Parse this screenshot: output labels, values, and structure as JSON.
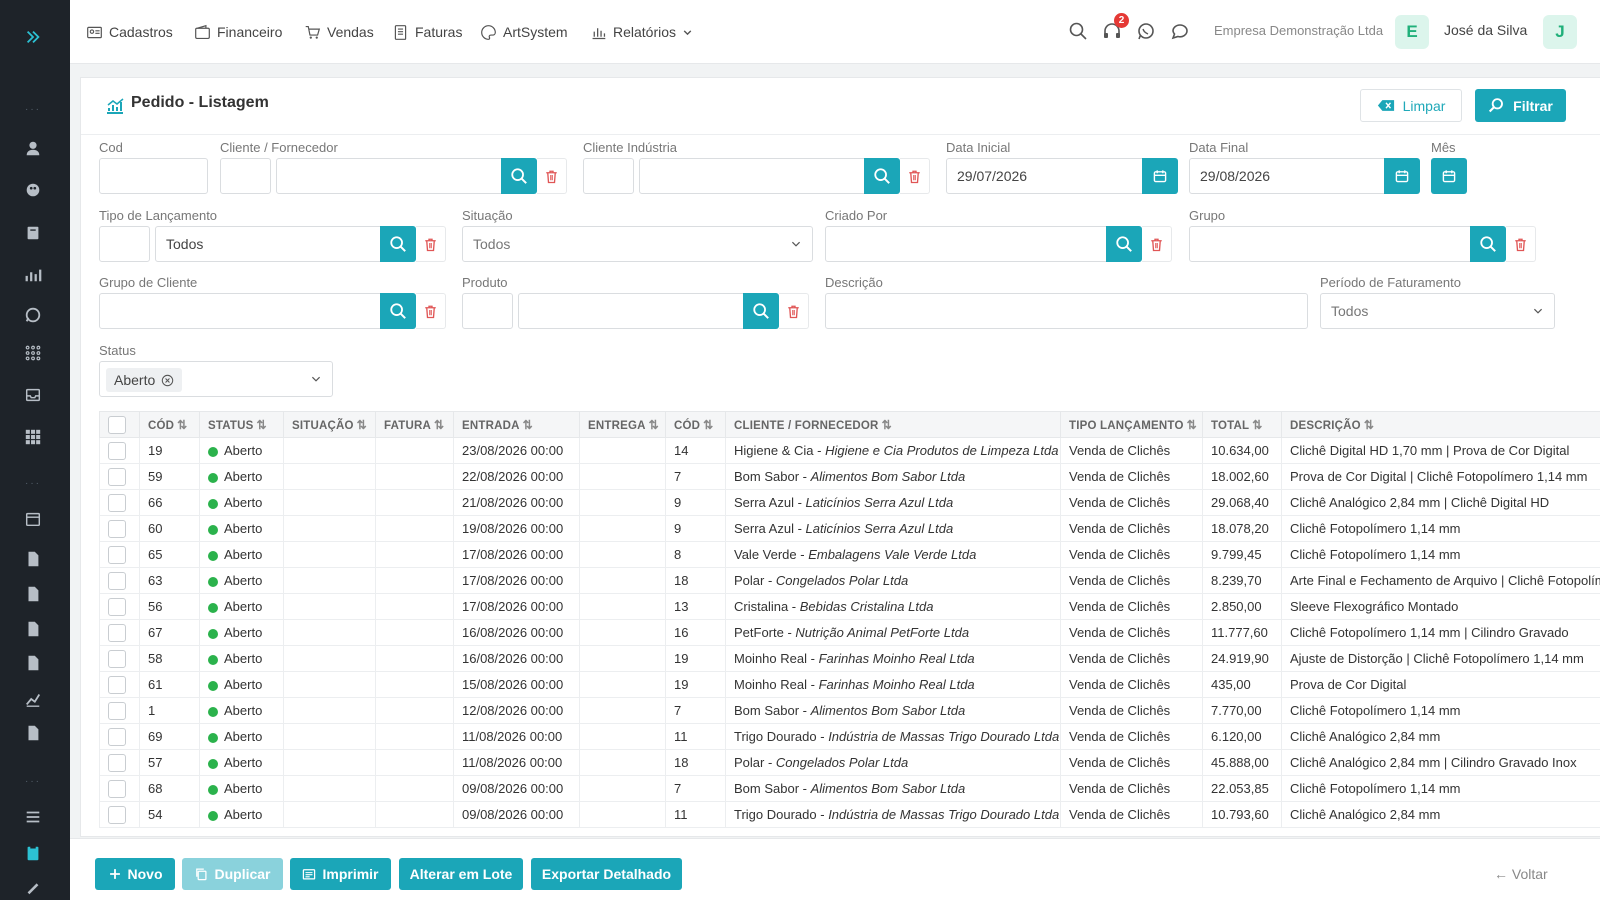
{
  "topnav": {
    "items": [
      "Cadastros",
      "Financeiro",
      "Vendas",
      "Faturas",
      "ArtSystem",
      "Relatórios"
    ],
    "notification_count": "2",
    "company": "Empresa Demonstração Ltda",
    "company_initial": "E",
    "user": "José da Silva",
    "user_initial": "J"
  },
  "page": {
    "title": "Pedido - Listagem",
    "clear_label": "Limpar",
    "filter_label": "Filtrar"
  },
  "filters": {
    "cod_label": "Cod",
    "cliente_label": "Cliente / Fornecedor",
    "industria_label": "Cliente Indústria",
    "data_inicial_label": "Data Inicial",
    "data_inicial": "29/07/2026",
    "data_final_label": "Data Final",
    "data_final": "29/08/2026",
    "mes_label": "Mês",
    "tipo_label": "Tipo de Lançamento",
    "tipo_value": "Todos",
    "situacao_label": "Situação",
    "situacao_value": "Todos",
    "criado_label": "Criado Por",
    "grupo_label": "Grupo",
    "grupo_cliente_label": "Grupo de Cliente",
    "produto_label": "Produto",
    "descricao_label": "Descrição",
    "periodo_label": "Período de Faturamento",
    "periodo_value": "Todos",
    "status_label": "Status",
    "status_tag": "Aberto"
  },
  "table": {
    "columns": [
      "CÓD",
      "STATUS",
      "SITUAÇÃO",
      "FATURA",
      "ENTRADA",
      "ENTREGA",
      "CÓD",
      "CLIENTE / FORNECEDOR",
      "TIPO LANÇAMENTO",
      "TOTAL",
      "DESCRIÇÃO"
    ],
    "rows": [
      {
        "cod": "19",
        "status": "Aberto",
        "entrada": "23/08/2026 00:00",
        "cli_cod": "14",
        "cliente": "Higiene & Cia",
        "razao": "Higiene e Cia Produtos de Limpeza Ltda",
        "tipo": "Venda de Clichês",
        "total": "10.634,00",
        "descricao": "Clichê Digital HD 1,70 mm | Prova de Cor Digital"
      },
      {
        "cod": "59",
        "status": "Aberto",
        "entrada": "22/08/2026 00:00",
        "cli_cod": "7",
        "cliente": "Bom Sabor",
        "razao": "Alimentos Bom Sabor Ltda",
        "tipo": "Venda de Clichês",
        "total": "18.002,60",
        "descricao": "Prova de Cor Digital | Clichê Fotopolímero 1,14 mm"
      },
      {
        "cod": "66",
        "status": "Aberto",
        "entrada": "21/08/2026 00:00",
        "cli_cod": "9",
        "cliente": "Serra Azul",
        "razao": "Laticínios Serra Azul Ltda",
        "tipo": "Venda de Clichês",
        "total": "29.068,40",
        "descricao": "Clichê Analógico 2,84 mm | Clichê Digital HD"
      },
      {
        "cod": "60",
        "status": "Aberto",
        "entrada": "19/08/2026 00:00",
        "cli_cod": "9",
        "cliente": "Serra Azul",
        "razao": "Laticínios Serra Azul Ltda",
        "tipo": "Venda de Clichês",
        "total": "18.078,20",
        "descricao": "Clichê Fotopolímero 1,14 mm"
      },
      {
        "cod": "65",
        "status": "Aberto",
        "entrada": "17/08/2026 00:00",
        "cli_cod": "8",
        "cliente": "Vale Verde",
        "razao": "Embalagens Vale Verde Ltda",
        "tipo": "Venda de Clichês",
        "total": "9.799,45",
        "descricao": "Clichê Fotopolímero 1,14 mm"
      },
      {
        "cod": "63",
        "status": "Aberto",
        "entrada": "17/08/2026 00:00",
        "cli_cod": "18",
        "cliente": "Polar",
        "razao": "Congelados Polar Ltda",
        "tipo": "Venda de Clichês",
        "total": "8.239,70",
        "descricao": "Arte Final e Fechamento de Arquivo | Clichê Fotopolímero"
      },
      {
        "cod": "56",
        "status": "Aberto",
        "entrada": "17/08/2026 00:00",
        "cli_cod": "13",
        "cliente": "Cristalina",
        "razao": "Bebidas Cristalina Ltda",
        "tipo": "Venda de Clichês",
        "total": "2.850,00",
        "descricao": "Sleeve Flexográfico Montado"
      },
      {
        "cod": "67",
        "status": "Aberto",
        "entrada": "16/08/2026 00:00",
        "cli_cod": "16",
        "cliente": "PetForte",
        "razao": "Nutrição Animal PetForte Ltda",
        "tipo": "Venda de Clichês",
        "total": "11.777,60",
        "descricao": "Clichê Fotopolímero 1,14 mm | Cilindro Gravado"
      },
      {
        "cod": "58",
        "status": "Aberto",
        "entrada": "16/08/2026 00:00",
        "cli_cod": "19",
        "cliente": "Moinho Real",
        "razao": "Farinhas Moinho Real Ltda",
        "tipo": "Venda de Clichês",
        "total": "24.919,90",
        "descricao": "Ajuste de Distorção | Clichê Fotopolímero 1,14 mm"
      },
      {
        "cod": "61",
        "status": "Aberto",
        "entrada": "15/08/2026 00:00",
        "cli_cod": "19",
        "cliente": "Moinho Real",
        "razao": "Farinhas Moinho Real Ltda",
        "tipo": "Venda de Clichês",
        "total": "435,00",
        "descricao": "Prova de Cor Digital"
      },
      {
        "cod": "1",
        "status": "Aberto",
        "entrada": "12/08/2026 00:00",
        "cli_cod": "7",
        "cliente": "Bom Sabor",
        "razao": "Alimentos Bom Sabor Ltda",
        "tipo": "Venda de Clichês",
        "total": "7.770,00",
        "descricao": "Clichê Fotopolímero 1,14 mm"
      },
      {
        "cod": "69",
        "status": "Aberto",
        "entrada": "11/08/2026 00:00",
        "cli_cod": "11",
        "cliente": "Trigo Dourado",
        "razao": "Indústria de Massas Trigo Dourado Ltda",
        "tipo": "Venda de Clichês",
        "total": "6.120,00",
        "descricao": "Clichê Analógico 2,84 mm"
      },
      {
        "cod": "57",
        "status": "Aberto",
        "entrada": "11/08/2026 00:00",
        "cli_cod": "18",
        "cliente": "Polar",
        "razao": "Congelados Polar Ltda",
        "tipo": "Venda de Clichês",
        "total": "45.888,00",
        "descricao": "Clichê Analógico 2,84 mm | Cilindro Gravado Inox"
      },
      {
        "cod": "68",
        "status": "Aberto",
        "entrada": "09/08/2026 00:00",
        "cli_cod": "7",
        "cliente": "Bom Sabor",
        "razao": "Alimentos Bom Sabor Ltda",
        "tipo": "Venda de Clichês",
        "total": "22.053,85",
        "descricao": "Clichê Fotopolímero 1,14 mm"
      },
      {
        "cod": "54",
        "status": "Aberto",
        "entrada": "09/08/2026 00:00",
        "cli_cod": "11",
        "cliente": "Trigo Dourado",
        "razao": "Indústria de Massas Trigo Dourado Ltda",
        "tipo": "Venda de Clichês",
        "total": "10.793,60",
        "descricao": "Clichê Analógico 2,84 mm"
      }
    ]
  },
  "bottom": {
    "novo": "Novo",
    "duplicar": "Duplicar",
    "imprimir": "Imprimir",
    "alterar": "Alterar em Lote",
    "exportar": "Exportar Detalhado",
    "voltar": "← Voltar"
  },
  "colors": {
    "accent": "#1ba6b8",
    "rail": "#1e2329",
    "status_open": "#2bb24c",
    "danger": "#e05555"
  }
}
